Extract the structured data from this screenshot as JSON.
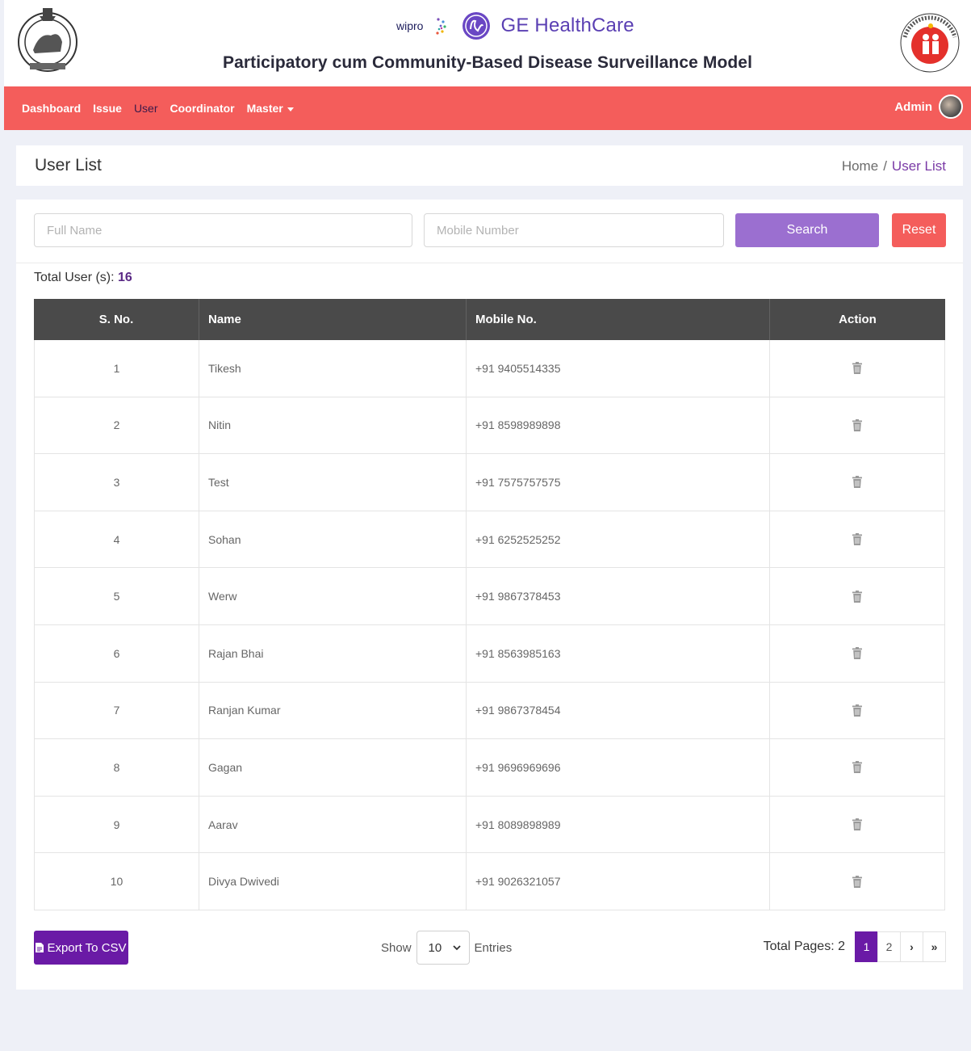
{
  "header": {
    "title": "Participatory cum Community-Based Disease Surveillance Model",
    "partner_wipro": "wipro",
    "partner_ge": "GE HealthCare"
  },
  "nav": {
    "items": [
      {
        "label": "Dashboard",
        "active": false
      },
      {
        "label": "Issue",
        "active": false
      },
      {
        "label": "User",
        "active": true
      },
      {
        "label": "Coordinator",
        "active": false
      },
      {
        "label": "Master",
        "active": false
      }
    ],
    "user_label": "Admin"
  },
  "page": {
    "title": "User List",
    "breadcrumb_home": "Home",
    "breadcrumb_sep": "/",
    "breadcrumb_current": "User List"
  },
  "filters": {
    "full_name_placeholder": "Full Name",
    "mobile_placeholder": "Mobile Number",
    "search_label": "Search",
    "reset_label": "Reset"
  },
  "summary": {
    "total_label": "Total User (s):",
    "total_count": "16"
  },
  "table": {
    "headers": [
      "S. No.",
      "Name",
      "Mobile No.",
      "Action"
    ],
    "rows": [
      {
        "sno": "1",
        "name": "Tikesh",
        "mobile": "+91 9405514335"
      },
      {
        "sno": "2",
        "name": "Nitin",
        "mobile": "+91 8598989898"
      },
      {
        "sno": "3",
        "name": "Test",
        "mobile": "+91 7575757575"
      },
      {
        "sno": "4",
        "name": "Sohan",
        "mobile": "+91 6252525252"
      },
      {
        "sno": "5",
        "name": "Werw",
        "mobile": "+91 9867378453"
      },
      {
        "sno": "6",
        "name": "Rajan Bhai",
        "mobile": "+91 8563985163"
      },
      {
        "sno": "7",
        "name": "Ranjan Kumar",
        "mobile": "+91 9867378454"
      },
      {
        "sno": "8",
        "name": "Gagan",
        "mobile": "+91 9696969696"
      },
      {
        "sno": "9",
        "name": "Aarav",
        "mobile": "+91 8089898989"
      },
      {
        "sno": "10",
        "name": "Divya Dwivedi",
        "mobile": "+91 9026321057"
      }
    ]
  },
  "footer": {
    "export_label": "Export To CSV",
    "show_label": "Show",
    "entries_value": "10",
    "entries_label": "Entries",
    "total_pages_label": "Total Pages: 2",
    "pages": [
      "1",
      "2"
    ],
    "next_label": "›",
    "last_label": "»"
  },
  "colors": {
    "navbar": "#f45d5b",
    "primary_purple": "#6a1aa6",
    "search_button": "#9b6fd0",
    "reset_button": "#f45d5b",
    "table_header": "#4a4a4a",
    "page_bg": "#eef0f7"
  },
  "icons": {
    "action": "trash-icon",
    "export": "file-icon",
    "select": "chevron-down-icon"
  }
}
